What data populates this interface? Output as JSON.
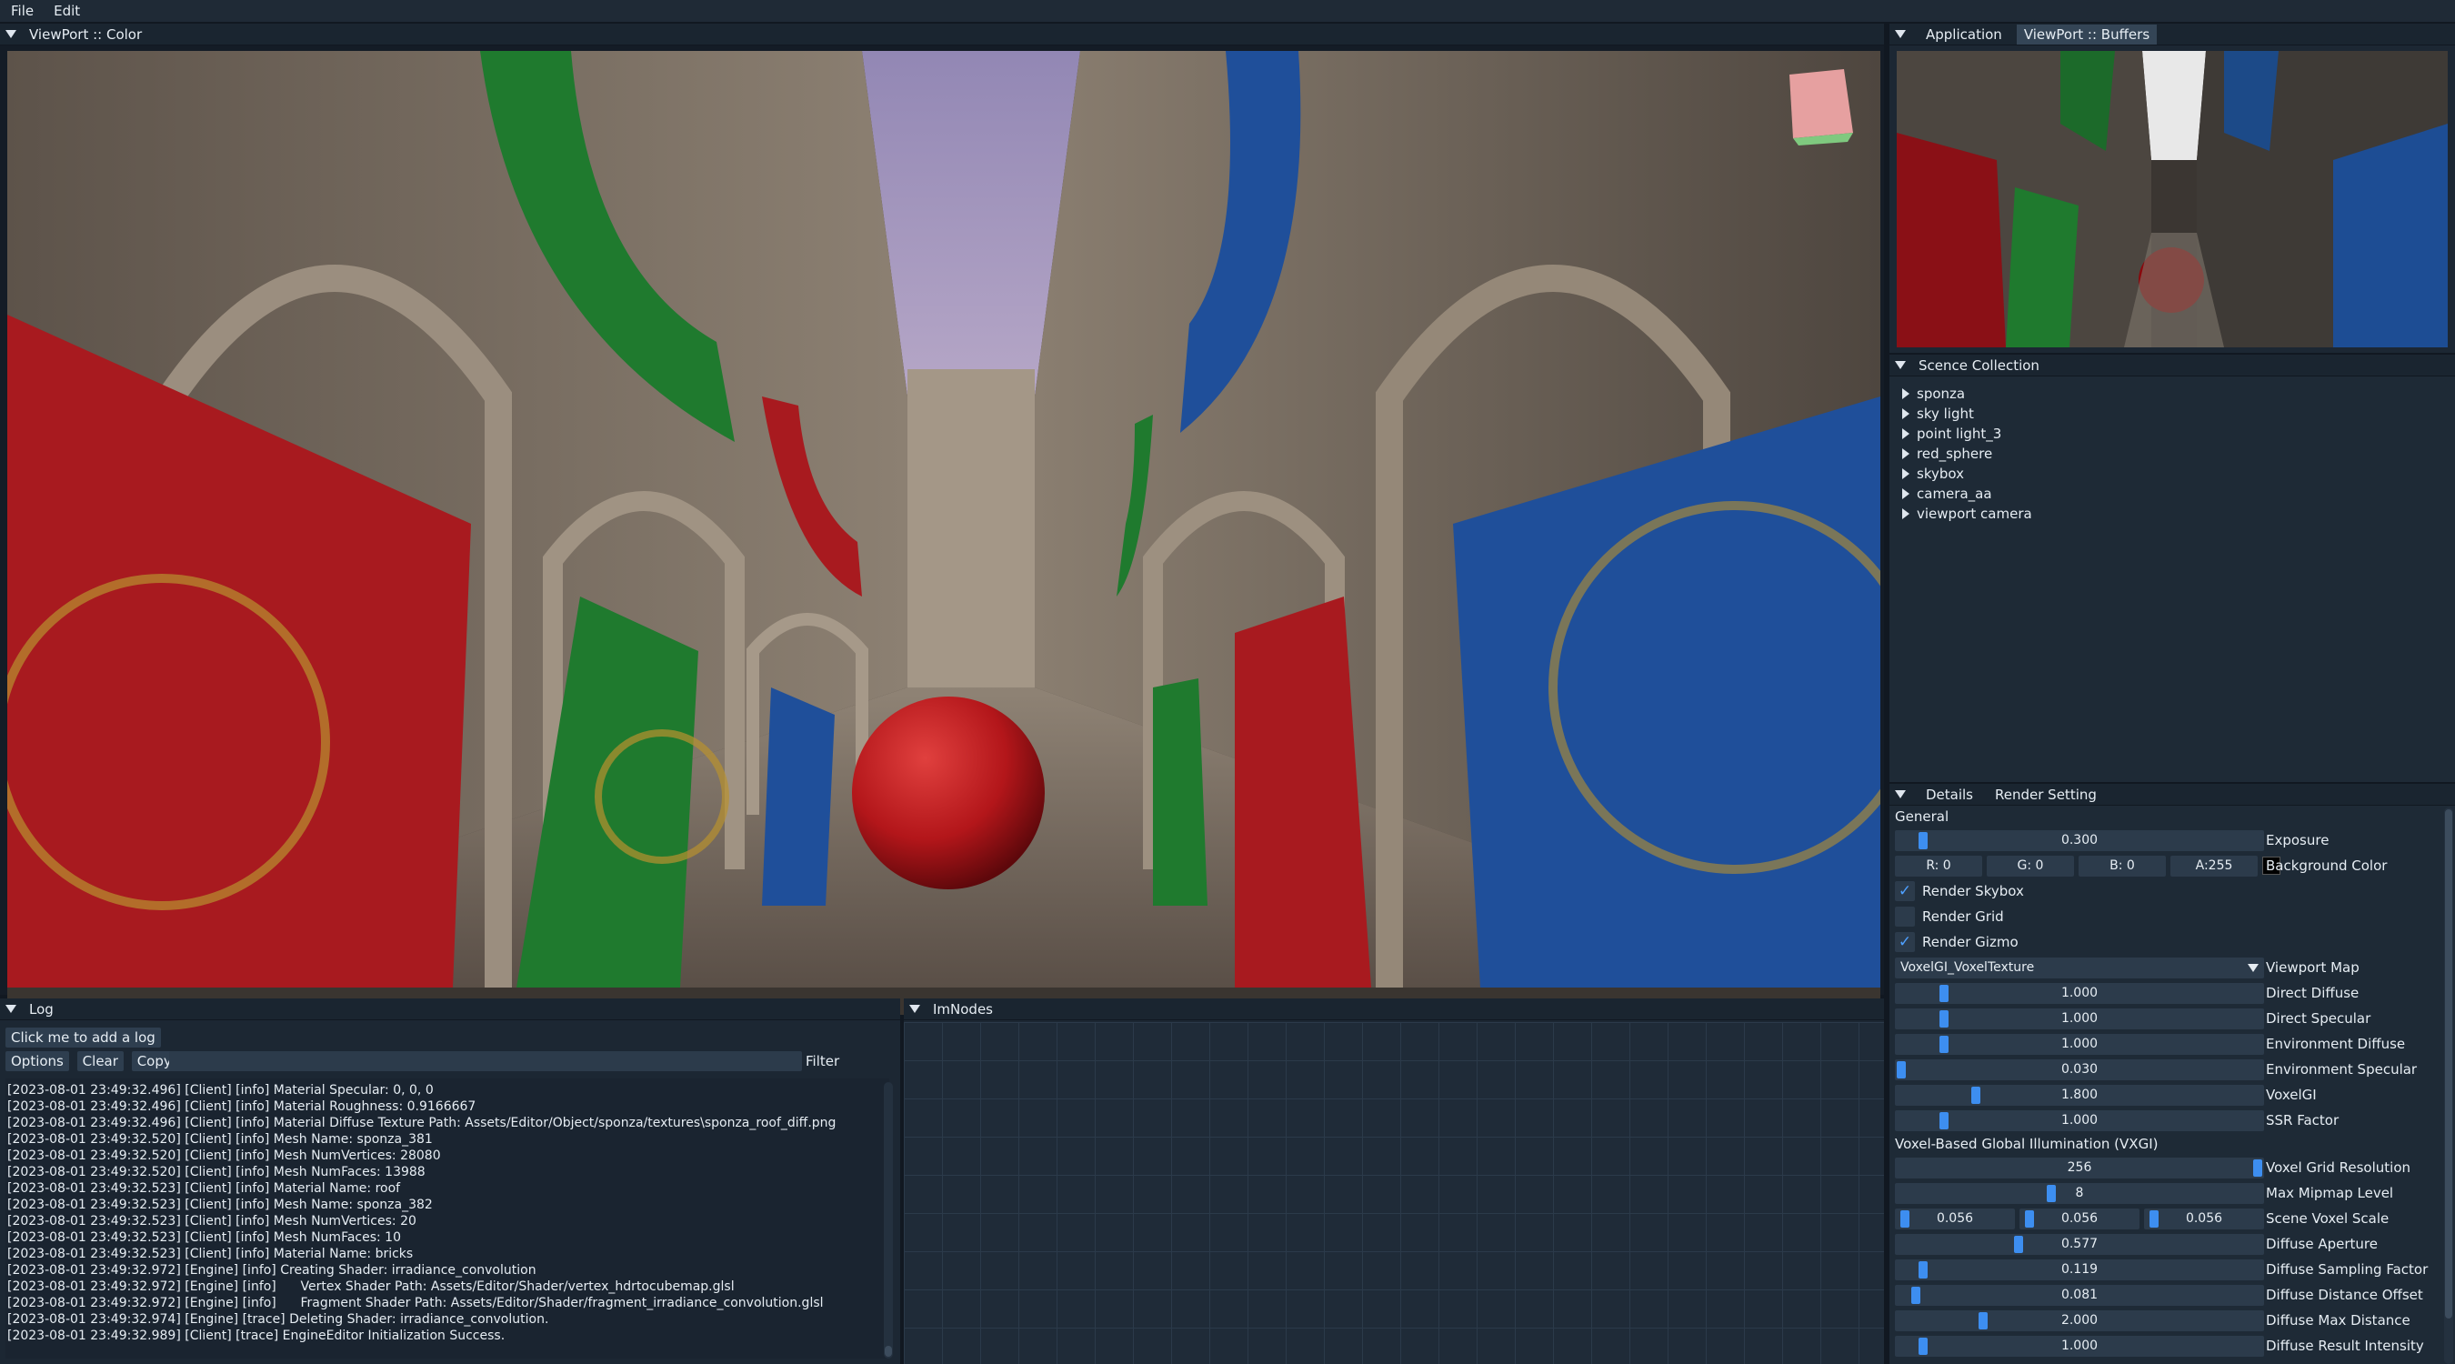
{
  "menu": {
    "file": "File",
    "edit": "Edit"
  },
  "viewport": {
    "title": "ViewPort :: Color"
  },
  "app_panel": {
    "tab_application": "Application",
    "tab_buffers": "ViewPort :: Buffers"
  },
  "scene_collection": {
    "title": "Scence Collection",
    "items": [
      "sponza",
      "sky light",
      "point light_3",
      "red_sphere",
      "skybox",
      "camera_aa",
      "viewport camera"
    ]
  },
  "details": {
    "tab_details": "Details",
    "tab_render": "Render Setting",
    "general_label": "General",
    "exposure": {
      "value": "0.300",
      "label": "Exposure",
      "fraction": 0.06
    },
    "background": {
      "r": "R:  0",
      "g": "G:  0",
      "b": "B:  0",
      "a": "A:255",
      "label": "Background Color",
      "swatch": "#000000"
    },
    "render_skybox": {
      "label": "Render Skybox",
      "checked": true
    },
    "render_grid": {
      "label": "Render Grid",
      "checked": false
    },
    "render_gizmo": {
      "label": "Render Gizmo",
      "checked": true
    },
    "viewport_map": {
      "value": "VoxelGI_VoxelTexture",
      "label": "Viewport Map"
    },
    "direct_diffuse": {
      "value": "1.000",
      "label": "Direct Diffuse",
      "fraction": 0.12
    },
    "direct_specular": {
      "value": "1.000",
      "label": "Direct Specular",
      "fraction": 0.12
    },
    "env_diffuse": {
      "value": "1.000",
      "label": "Environment Diffuse",
      "fraction": 0.12
    },
    "env_specular": {
      "value": "0.030",
      "label": "Environment Specular",
      "fraction": 0.0
    },
    "voxelgi": {
      "value": "1.800",
      "label": "VoxelGI",
      "fraction": 0.21
    },
    "ssr_factor": {
      "value": "1.000",
      "label": "SSR Factor",
      "fraction": 0.12
    },
    "vxgi_label": "Voxel-Based Global Illumination (VXGI)",
    "grid_resolution": {
      "value": "256",
      "label": "Voxel Grid Resolution",
      "fraction": 1.0
    },
    "max_mip": {
      "value": "8",
      "label": "Max Mipmap Level",
      "fraction": 0.42
    },
    "voxel_scale": {
      "x": "0.056",
      "y": "0.056",
      "z": "0.056",
      "label": "Scene Voxel Scale"
    },
    "diffuse_aperture": {
      "value": "0.577",
      "label": "Diffuse Aperture",
      "fraction": 0.33
    },
    "diffuse_sampling": {
      "value": "0.119",
      "label": "Diffuse Sampling Factor",
      "fraction": 0.06
    },
    "diffuse_offset": {
      "value": "0.081",
      "label": "Diffuse Distance Offset",
      "fraction": 0.04
    },
    "diffuse_max": {
      "value": "2.000",
      "label": "Diffuse Max Distance",
      "fraction": 0.23
    },
    "diffuse_intensity": {
      "value": "1.000",
      "label": "Diffuse Result Intensity",
      "fraction": 0.06
    }
  },
  "log": {
    "title": "Log",
    "add_button": "Click me to add a log",
    "options": "Options",
    "clear": "Clear",
    "copy": "Copy",
    "filter": "Filter",
    "lines": [
      "[2023-08-01 23:49:32.496] [Client] [info] Material Specular: 0, 0, 0",
      "[2023-08-01 23:49:32.496] [Client] [info] Material Roughness: 0.9166667",
      "[2023-08-01 23:49:32.496] [Client] [info] Material Diffuse Texture Path: Assets/Editor/Object/sponza/textures\\sponza_roof_diff.png",
      "[2023-08-01 23:49:32.520] [Client] [info] Mesh Name: sponza_381",
      "[2023-08-01 23:49:32.520] [Client] [info] Mesh NumVertices: 28080",
      "[2023-08-01 23:49:32.520] [Client] [info] Mesh NumFaces: 13988",
      "[2023-08-01 23:49:32.523] [Client] [info] Material Name: roof",
      "[2023-08-01 23:49:32.523] [Client] [info] Mesh Name: sponza_382",
      "[2023-08-01 23:49:32.523] [Client] [info] Mesh NumVertices: 20",
      "[2023-08-01 23:49:32.523] [Client] [info] Mesh NumFaces: 10",
      "[2023-08-01 23:49:32.523] [Client] [info] Material Name: bricks",
      "[2023-08-01 23:49:32.972] [Engine] [info] Creating Shader: irradiance_convolution",
      "[2023-08-01 23:49:32.972] [Engine] [info]      Vertex Shader Path: Assets/Editor/Shader/vertex_hdrtocubemap.glsl",
      "[2023-08-01 23:49:32.972] [Engine] [info]      Fragment Shader Path: Assets/Editor/Shader/fragment_irradiance_convolution.glsl",
      "[2023-08-01 23:49:32.974] [Engine] [trace] Deleting Shader: irradiance_convolution.",
      "[2023-08-01 23:49:32.989] [Client] [trace] EngineEditor Initialization Success."
    ]
  },
  "imnodes": {
    "title": "ImNodes"
  },
  "colors": {
    "accent": "#3d8ef0",
    "sphere": "#c2181c",
    "banner_red": "#a81a1f",
    "banner_green": "#1f7a2e",
    "banner_blue": "#1f4f9a"
  }
}
